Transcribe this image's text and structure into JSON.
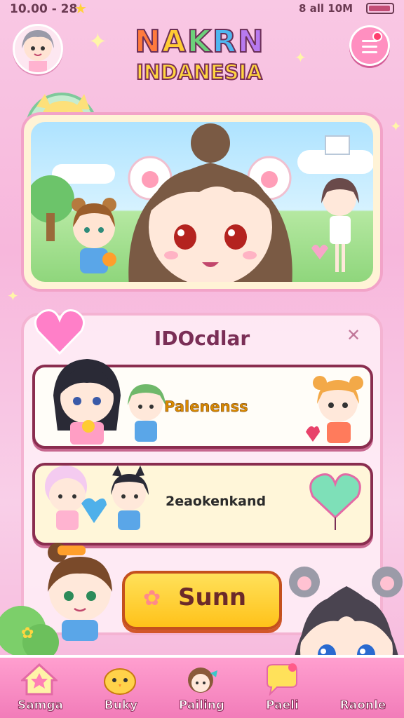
{
  "status_bar": {
    "time": "10.00 - 28",
    "signal": "8 all 10M"
  },
  "header": {
    "logo_line1": [
      "N",
      "A",
      "K",
      "R",
      "N"
    ],
    "logo_line2": "INDANESIA"
  },
  "panel": {
    "title": "IDOcdlar"
  },
  "cards": [
    {
      "label": "Palenenss"
    },
    {
      "label": "2eaokenkand"
    }
  ],
  "action_button": {
    "label": "Sunn"
  },
  "tabs": [
    {
      "label": "Samga",
      "icon": "house-icon"
    },
    {
      "label": "Buky",
      "icon": "chick-icon"
    },
    {
      "label": "Pailing",
      "icon": "girl-avatar-icon"
    },
    {
      "label": "Paeli",
      "icon": "chat-bubble-icon"
    },
    {
      "label": "Raonle",
      "icon": "profile-icon"
    }
  ],
  "colors": {
    "accent": "#ff8fc0",
    "panel_border": "#8a2d4f",
    "button": "#ffc21a"
  }
}
